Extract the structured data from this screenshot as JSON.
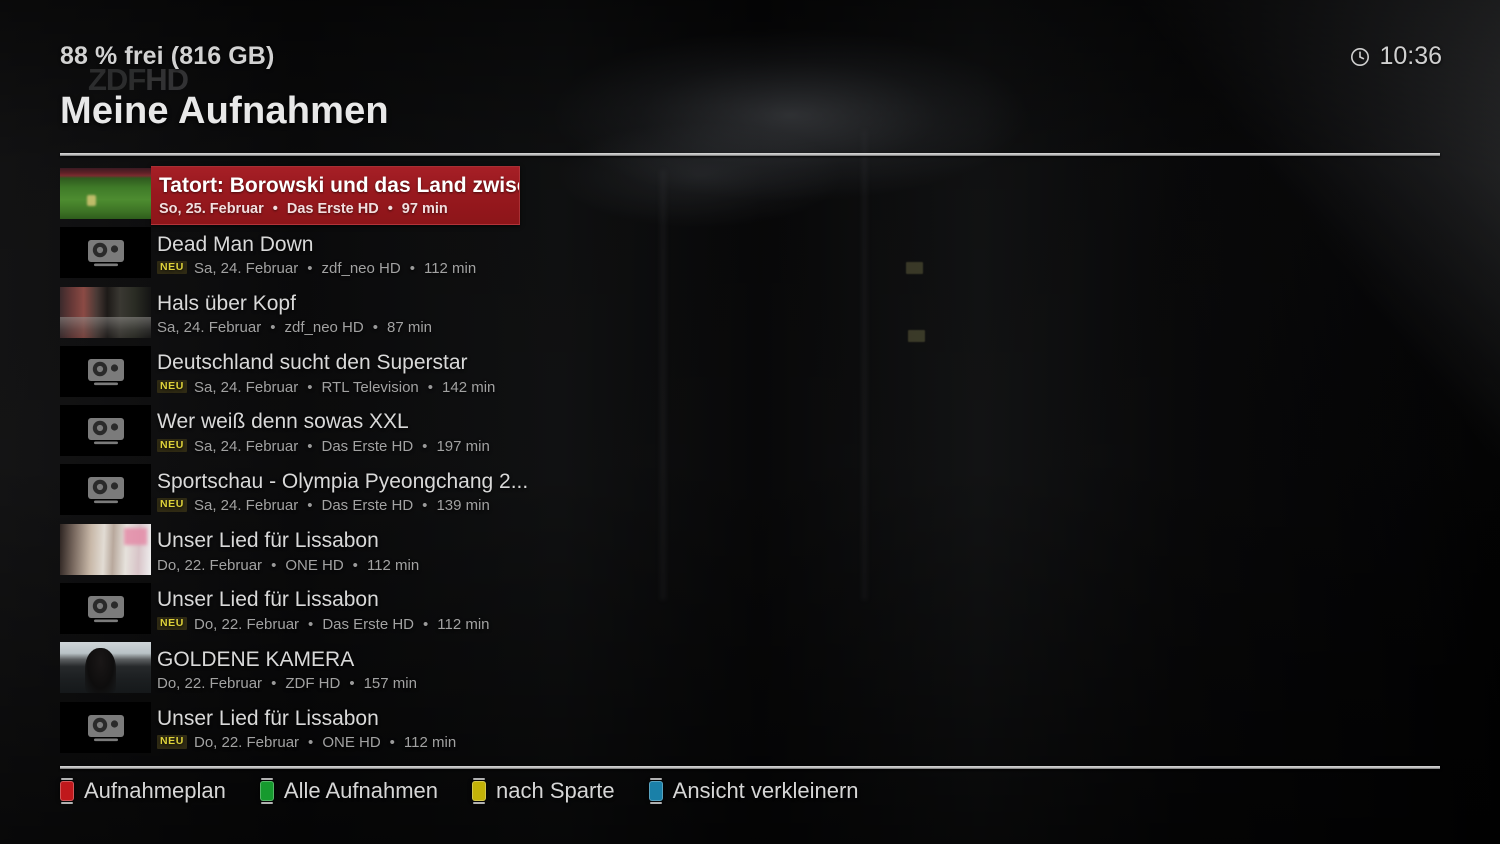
{
  "header": {
    "disk_free": "88 % frei (816 GB)",
    "clock_icon": "clock-icon",
    "time": "10:36",
    "page_title": "Meine Aufnahmen",
    "watermark_zdf": "ZDF",
    "watermark_hd": "HD"
  },
  "list": {
    "recordings": [
      {
        "title": "Tatort: Borowski und das Land zwisc...",
        "date": "So, 25. Februar",
        "channel": "Das Erste HD",
        "duration": "97 min",
        "new_badge": "",
        "selected": true,
        "thumb": "football-thumbnail"
      },
      {
        "title": "Dead Man Down",
        "date": "Sa, 24. Februar",
        "channel": "zdf_neo HD",
        "duration": "112 min",
        "new_badge": "NEU",
        "selected": false,
        "thumb": "camera-placeholder-icon"
      },
      {
        "title": "Hals über Kopf",
        "date": "Sa, 24. Februar",
        "channel": "zdf_neo HD",
        "duration": "87 min",
        "new_badge": "",
        "selected": false,
        "thumb": "street-thumbnail"
      },
      {
        "title": "Deutschland sucht den Superstar",
        "date": "Sa, 24. Februar",
        "channel": "RTL Television",
        "duration": "142 min",
        "new_badge": "NEU",
        "selected": false,
        "thumb": "camera-placeholder-icon"
      },
      {
        "title": "Wer weiß denn sowas XXL",
        "date": "Sa, 24. Februar",
        "channel": "Das Erste HD",
        "duration": "197 min",
        "new_badge": "NEU",
        "selected": false,
        "thumb": "camera-placeholder-icon"
      },
      {
        "title": "Sportschau - Olympia Pyeongchang 2...",
        "date": "Sa, 24. Februar",
        "channel": "Das Erste HD",
        "duration": "139 min",
        "new_badge": "NEU",
        "selected": false,
        "thumb": "camera-placeholder-icon"
      },
      {
        "title": "Unser Lied für Lissabon",
        "date": "Do, 22. Februar",
        "channel": "ONE HD",
        "duration": "112 min",
        "new_badge": "",
        "selected": false,
        "thumb": "crowd-thumbnail"
      },
      {
        "title": "Unser Lied für Lissabon",
        "date": "Do, 22. Februar",
        "channel": "Das Erste HD",
        "duration": "112 min",
        "new_badge": "NEU",
        "selected": false,
        "thumb": "camera-placeholder-icon"
      },
      {
        "title": "GOLDENE KAMERA",
        "date": "Do, 22. Februar",
        "channel": "ZDF HD",
        "duration": "157 min",
        "new_badge": "",
        "selected": false,
        "thumb": "uniform-thumbnail"
      },
      {
        "title": "Unser Lied für Lissabon",
        "date": "Do, 22. Februar",
        "channel": "ONE HD",
        "duration": "112 min",
        "new_badge": "NEU",
        "selected": false,
        "thumb": "camera-placeholder-icon"
      }
    ],
    "separator": "•"
  },
  "keybar": {
    "items": [
      {
        "label": "Aufnahmeplan",
        "color": "#c0181c",
        "key": "red-key-button"
      },
      {
        "label": "Alle Aufnahmen",
        "color": "#169a2e",
        "key": "green-key-button"
      },
      {
        "label": "nach Sparte",
        "color": "#c2b208",
        "key": "yellow-key-button"
      },
      {
        "label": "Ansicht verkleinern",
        "color": "#1a80a8",
        "key": "blue-key-button"
      }
    ]
  },
  "colors": {
    "selection_red": "#99191f",
    "new_badge_text": "#ded23a",
    "title_text": "#d9d9d9",
    "meta_text": "#a2a2a2"
  }
}
